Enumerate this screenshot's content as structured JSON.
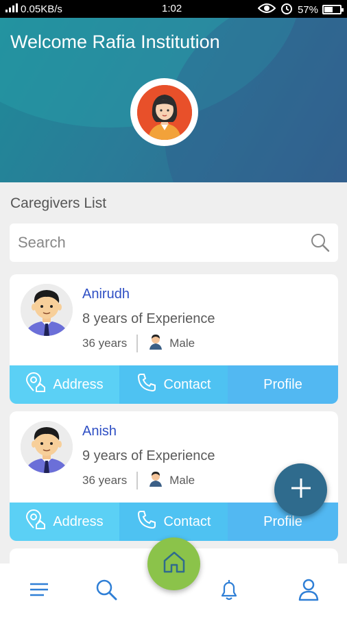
{
  "status_bar": {
    "network_speed": "0.05KB/s",
    "time": "1:02",
    "battery": "57%"
  },
  "header": {
    "welcome": "Welcome Rafia Institution"
  },
  "section_title": "Caregivers List",
  "search": {
    "placeholder": "Search"
  },
  "caregivers": [
    {
      "name": "Anirudh",
      "experience": "8 years of Experience",
      "age": "36 years",
      "gender": "Male"
    },
    {
      "name": "Anish",
      "experience": "9 years of Experience",
      "age": "36 years",
      "gender": "Male"
    }
  ],
  "card_actions": {
    "address": "Address",
    "contact": "Contact",
    "profile": "Profile"
  },
  "colors": {
    "accent": "#2e4fc4",
    "action_blue": "#52b8f2",
    "fab": "#2f6b8d",
    "home": "#8bc34a",
    "nav_icon": "#2f7fd6"
  },
  "bottom_nav": [
    "menu-icon",
    "search-icon",
    "home-icon",
    "bell-icon",
    "user-icon"
  ]
}
